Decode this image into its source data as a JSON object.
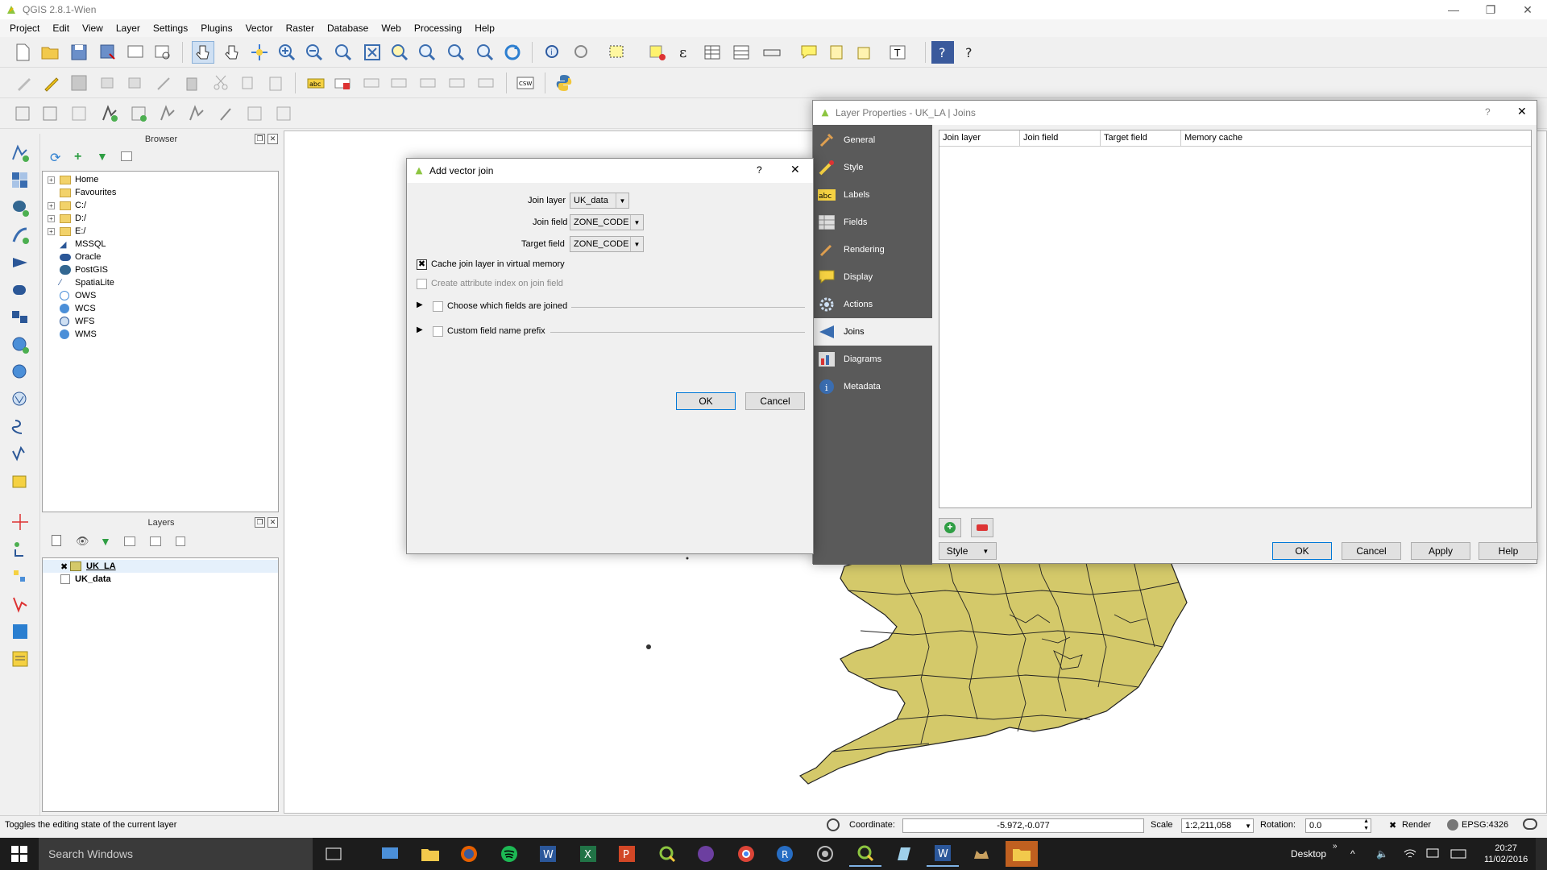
{
  "window": {
    "title": "QGIS 2.8.1-Wien"
  },
  "menu": [
    "Project",
    "Edit",
    "View",
    "Layer",
    "Settings",
    "Plugins",
    "Vector",
    "Raster",
    "Database",
    "Web",
    "Processing",
    "Help"
  ],
  "browser": {
    "title": "Browser",
    "items": [
      "Home",
      "Favourites",
      "C:/",
      "D:/",
      "E:/",
      "MSSQL",
      "Oracle",
      "PostGIS",
      "SpatiaLite",
      "OWS",
      "WCS",
      "WFS",
      "WMS"
    ]
  },
  "layers": {
    "title": "Layers",
    "items": [
      {
        "name": "UK_LA",
        "checked": "✖"
      },
      {
        "name": "UK_data"
      }
    ]
  },
  "layer_properties": {
    "title": "Layer Properties - UK_LA | Joins",
    "help": "?",
    "sections": [
      "General",
      "Style",
      "Labels",
      "Fields",
      "Rendering",
      "Display",
      "Actions",
      "Joins",
      "Diagrams",
      "Metadata"
    ],
    "active_section": "Joins",
    "table_headers": [
      "Join layer",
      "Join field",
      "Target field",
      "Memory cache"
    ],
    "style_button": "Style",
    "ok": "OK",
    "cancel": "Cancel",
    "apply": "Apply",
    "help_button": "Help"
  },
  "add_join": {
    "title": "Add vector join",
    "help": "?",
    "join_layer_label": "Join layer",
    "join_layer_value": "UK_data",
    "join_field_label": "Join field",
    "join_field_value": "ZONE_CODE",
    "target_field_label": "Target field",
    "target_field_value": "ZONE_CODE",
    "cache_label": "Cache join layer in virtual memory",
    "cache_checked": "✖",
    "index_label": "Create attribute index on join field",
    "choose_fields_label": "Choose which fields are joined",
    "prefix_label": "Custom field name prefix",
    "ok": "OK",
    "cancel": "Cancel"
  },
  "statusbar": {
    "message": "Toggles the editing state of the current layer",
    "coordinate_label": "Coordinate:",
    "coordinate_value": "-5.972,-0.077",
    "scale_label": "Scale",
    "scale_value": "1:2,211,058",
    "rotation_label": "Rotation:",
    "rotation_value": "0.0",
    "render_label": "Render",
    "render_checked": "✖",
    "crs": "EPSG:4326"
  },
  "taskbar": {
    "search_placeholder": "Search Windows",
    "desktop_label": "Desktop",
    "time": "20:27",
    "date": "11/02/2016"
  },
  "colors": {
    "map_fill": "#d4c96a",
    "sidebar_bg": "#5a5a5a",
    "accent": "#0078d7"
  }
}
